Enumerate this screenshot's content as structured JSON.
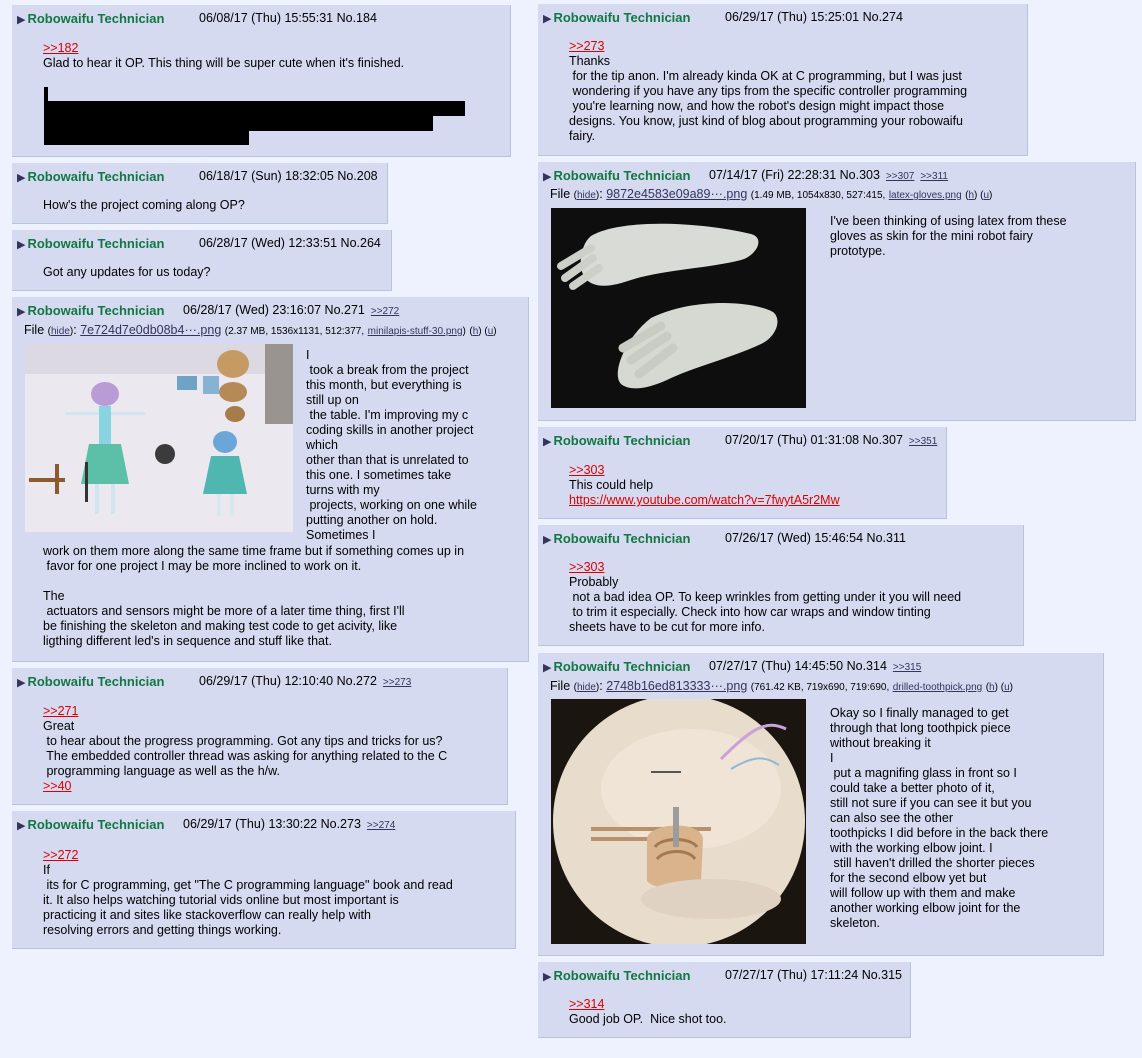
{
  "author": "Robowaifu Technician",
  "posts": {
    "p184": {
      "date": "06/08/17 (Thu) 15:55:31",
      "no": "No.184",
      "lines": [
        ">>182",
        "Glad to hear it OP. This thing will be super cute when it's finished."
      ]
    },
    "p208": {
      "date": "06/18/17 (Sun) 18:32:05",
      "no": "No.208",
      "lines": [
        "How's the project coming along OP?"
      ]
    },
    "p264": {
      "date": "06/28/17 (Wed) 12:33:51",
      "no": "No.264",
      "lines": [
        "Got any updates for us today?"
      ]
    },
    "p271": {
      "date": "06/28/17 (Wed) 23:16:07",
      "no": "No.271",
      "backlinks": [
        ">>272"
      ],
      "file": {
        "label": "File",
        "hide": "hide",
        "name": "7e724d7e0db08b4···.png",
        "meta": "(2.37 MB, 1536x1131, 512:377,",
        "orig": "minilapis-stuff-30.png",
        "h": "h",
        "u": "u"
      },
      "side_lines": [
        "I",
        " took a break from the project",
        "this month, but everything is",
        "still up on",
        " the table. I'm improving my c",
        "coding skills in another project",
        "which",
        "other than that is unrelated to",
        "this one. I sometimes take",
        "turns with my",
        " projects, working on one while",
        "putting another on hold.",
        "Sometimes I"
      ],
      "lines": [
        "work on them more along the same time frame but if something comes up in",
        " favor for one project I may be more inclined to work on it.",
        "",
        "The",
        " actuators and sensors might be more of a later time thing, first I'll",
        "be finishing the skeleton and making test code to get acivity, like",
        "ligthing different led's in sequence and stuff like that."
      ]
    },
    "p272": {
      "date": "06/29/17 (Thu) 12:10:40",
      "no": "No.272",
      "backlinks": [
        ">>273"
      ],
      "lines": [
        ">>271",
        "Great",
        " to hear about the progress programming. Got any tips and tricks for us?",
        " The embedded controller thread was asking for anything related to the C",
        " programming language as well as the h/w.",
        ">>40"
      ]
    },
    "p273": {
      "date": "06/29/17 (Thu) 13:30:22",
      "no": "No.273",
      "backlinks": [
        ">>274"
      ],
      "lines": [
        ">>272",
        "If",
        " its for C programming, get \"The C programming language\" book and read",
        "it. It also helps watching tutorial vids online but most important is",
        "practicing it and sites like stackoverflow can really help with",
        "resolving errors and getting things working."
      ]
    },
    "p274": {
      "date": "06/29/17 (Thu) 15:25:01",
      "no": "No.274",
      "lines": [
        ">>273",
        "Thanks",
        " for the tip anon. I'm already kinda OK at C programming, but I was just",
        " wondering if you have any tips from the specific controller programming",
        " you're learning now, and how the robot's design might impact those",
        "designs. You know, just kind of blog about programming your robowaifu",
        "fairy."
      ]
    },
    "p303": {
      "date": "07/14/17 (Fri) 22:28:31",
      "no": "No.303",
      "backlinks": [
        ">>307",
        ">>311"
      ],
      "file": {
        "label": "File",
        "hide": "hide",
        "name": "9872e4583e09a89···.png",
        "meta": "(1.49 MB, 1054x830, 527:415,",
        "orig": "latex-gloves.png",
        "h": "h",
        "u": "u"
      },
      "side_lines": [
        "I've been thinking of using latex from these",
        "gloves as skin for the mini robot fairy",
        "prototype."
      ]
    },
    "p307": {
      "date": "07/20/17 (Thu) 01:31:08",
      "no": "No.307",
      "backlinks": [
        ">>351"
      ],
      "lines": [
        ">>303",
        "This could help",
        "https://www.youtube.com/watch?v=7fwytA5r2Mw"
      ]
    },
    "p311": {
      "date": "07/26/17 (Wed) 15:46:54",
      "no": "No.311",
      "lines": [
        ">>303",
        "Probably",
        " not a bad idea OP. To keep wrinkles from getting under it you will need",
        " to trim it especially. Check into how car wraps and window tinting",
        "sheets have to be cut for more info."
      ]
    },
    "p314": {
      "date": "07/27/17 (Thu) 14:45:50",
      "no": "No.314",
      "backlinks": [
        ">>315"
      ],
      "file": {
        "label": "File",
        "hide": "hide",
        "name": "2748b16ed813333···.png",
        "meta": "(761.42 KB, 719x690, 719:690,",
        "orig": "drilled-toothpick.png",
        "h": "h",
        "u": "u"
      },
      "side_lines": [
        "Okay so I finally managed to get",
        "through that long toothpick piece",
        "without breaking it",
        "I",
        " put a magnifing glass in front so I",
        "could take a better photo of it,",
        "still not sure if you can see it but you",
        "can also see the other",
        "toothpicks I did before in the back there",
        "with the working elbow joint. I",
        " still haven't drilled the shorter pieces",
        "for the second elbow yet but",
        "will follow up with them and make",
        "another working elbow joint for the",
        "skeleton."
      ]
    },
    "p315": {
      "date": "07/27/17 (Thu) 17:11:24",
      "no": "No.315",
      "lines": [
        ">>314",
        "Good job OP.  Nice shot too."
      ]
    }
  }
}
